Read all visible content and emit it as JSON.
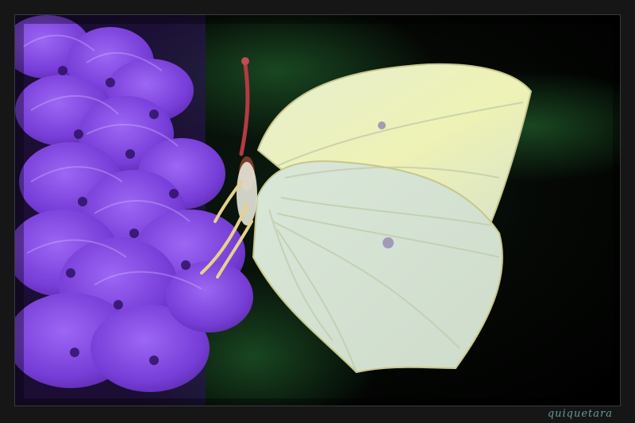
{
  "photo": {
    "subject": "butterfly-on-flower",
    "signature": "quiquetara",
    "colors": {
      "background": "#050505",
      "bokeh_green": "#0f3a1c",
      "flower_violet": "#7b3fe0",
      "flower_light": "#a46cff",
      "wing_pale": "#dfe8c8",
      "wing_yellow": "#eaf0b0",
      "wing_edge": "#b7b47a"
    },
    "icons": [
      "butterfly-icon",
      "verbena-flower-icon"
    ]
  }
}
